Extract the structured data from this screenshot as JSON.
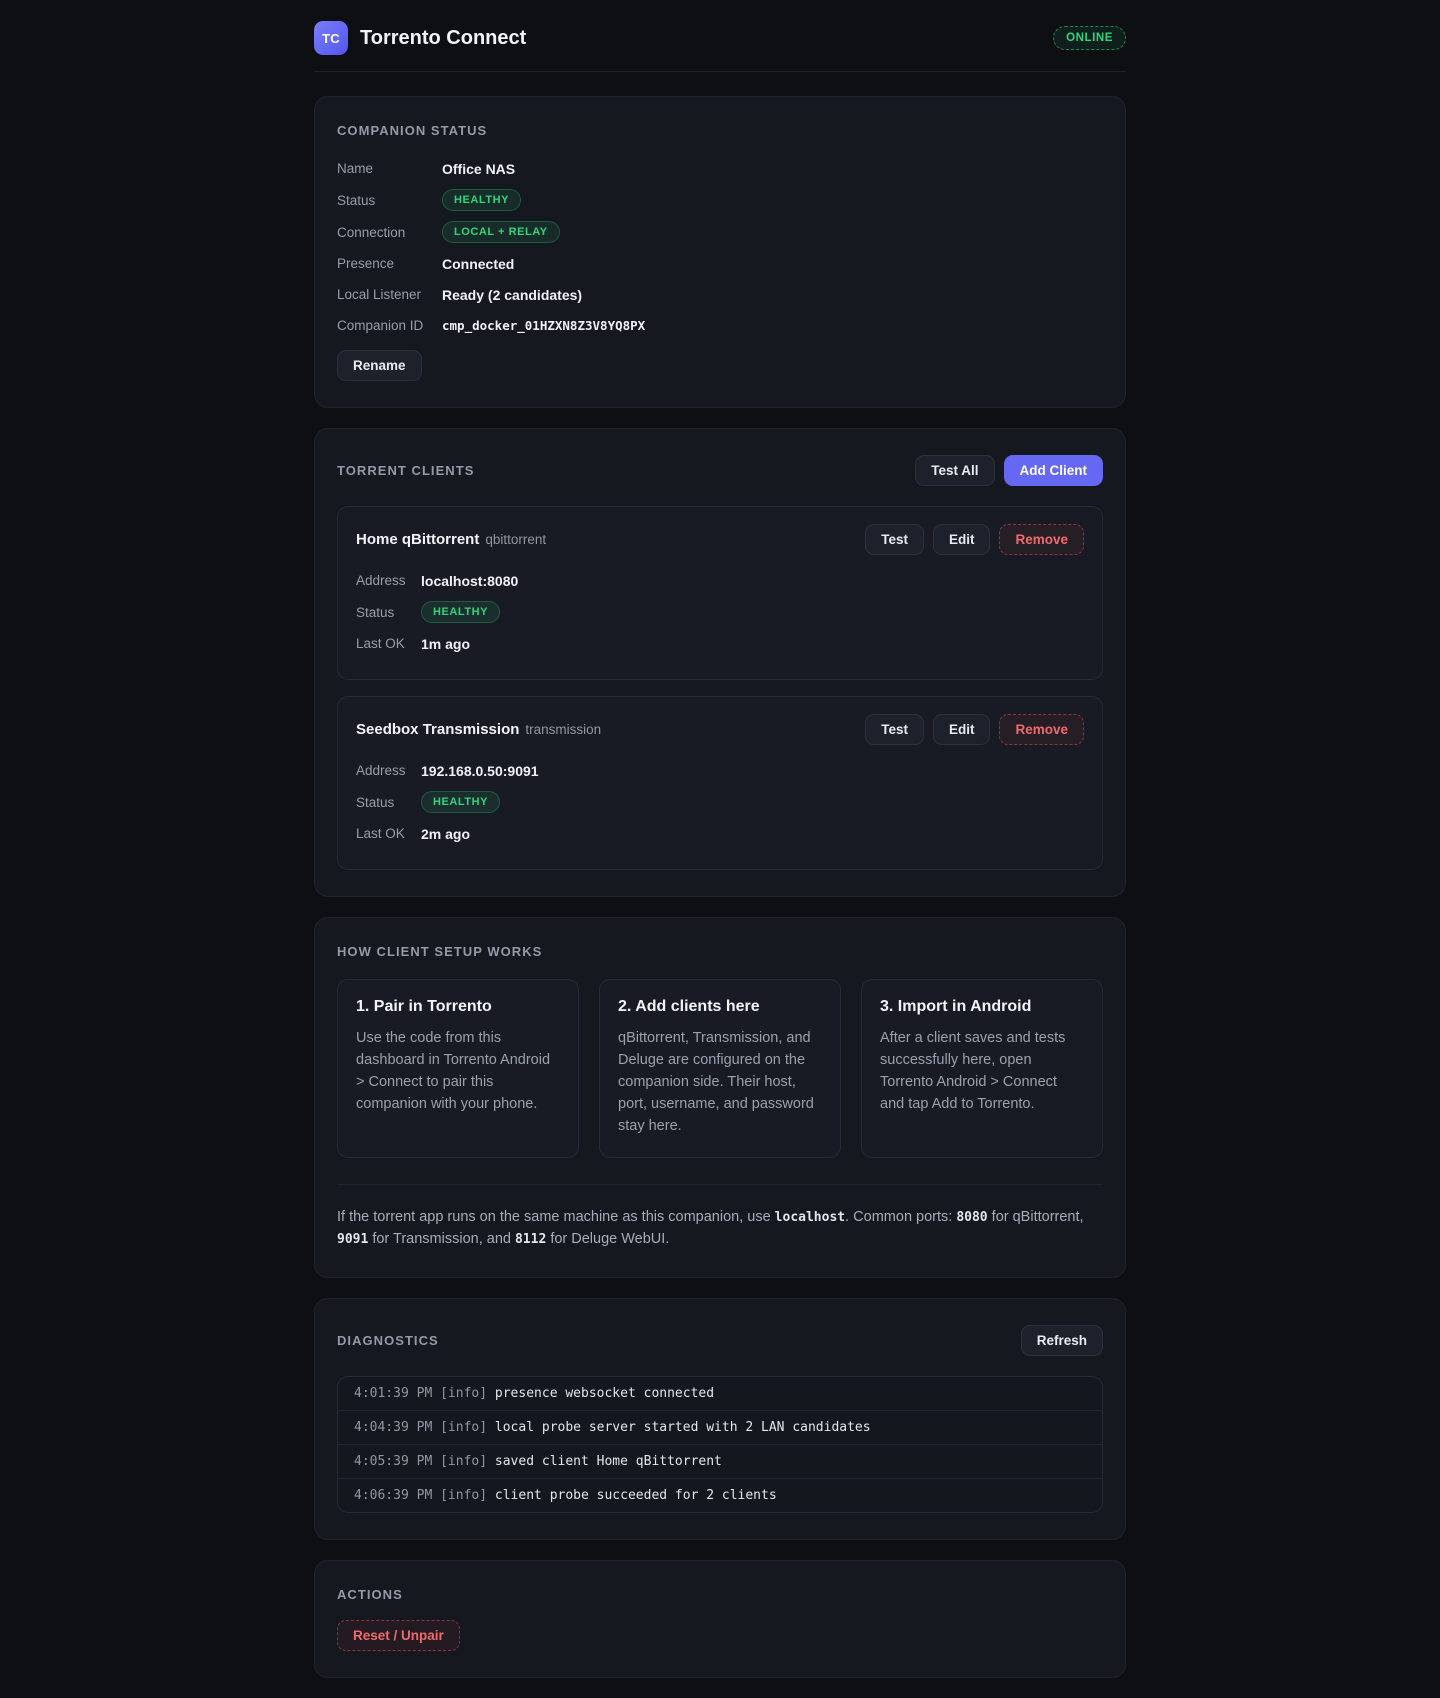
{
  "header": {
    "logo": "TC",
    "title": "Torrento Connect",
    "status_badge": "ONLINE"
  },
  "companion_status": {
    "section_title": "Companion Status",
    "fields": [
      {
        "label": "Name",
        "value": "Office NAS",
        "type": "text"
      },
      {
        "label": "Status",
        "value": "HEALTHY",
        "type": "badge"
      },
      {
        "label": "Connection",
        "value": "LOCAL + RELAY",
        "type": "badge"
      },
      {
        "label": "Presence",
        "value": "Connected",
        "type": "text"
      },
      {
        "label": "Local Listener",
        "value": "Ready (2 candidates)",
        "type": "text"
      },
      {
        "label": "Companion ID",
        "value": "cmp_docker_01HZXN8Z3V8YQ8PX",
        "type": "mono"
      }
    ],
    "rename_button": "Rename"
  },
  "torrent_clients": {
    "section_title": "Torrent Clients",
    "test_all_button": "Test All",
    "add_client_button": "Add Client",
    "field_labels": {
      "address": "Address",
      "status": "Status",
      "last_ok": "Last OK"
    },
    "client_buttons": {
      "test": "Test",
      "edit": "Edit",
      "remove": "Remove"
    },
    "clients": [
      {
        "name": "Home qBittorrent",
        "kind": "qbittorrent",
        "address": "localhost:8080",
        "status": "HEALTHY",
        "last_ok": "1m ago"
      },
      {
        "name": "Seedbox Transmission",
        "kind": "transmission",
        "address": "192.168.0.50:9091",
        "status": "HEALTHY",
        "last_ok": "2m ago"
      }
    ]
  },
  "how_it_works": {
    "section_title": "How Client Setup Works",
    "steps": [
      {
        "title": "1. Pair in Torrento",
        "body": "Use the code from this dashboard in Torrento Android > Connect to pair this companion with your phone."
      },
      {
        "title": "2. Add clients here",
        "body": "qBittorrent, Transmission, and Deluge are configured on the companion side. Their host, port, username, and password stay here."
      },
      {
        "title": "3. Import in Android",
        "body": "After a client saves and tests successfully here, open Torrento Android > Connect and tap Add to Torrento."
      }
    ],
    "note_segments": [
      {
        "text": "If the torrent app runs on the same machine as this companion, use ",
        "style": "plain"
      },
      {
        "text": "localhost",
        "style": "code"
      },
      {
        "text": ". Common ports: ",
        "style": "plain"
      },
      {
        "text": "8080",
        "style": "code"
      },
      {
        "text": " for qBittorrent, ",
        "style": "plain"
      },
      {
        "text": "9091",
        "style": "code"
      },
      {
        "text": " for Transmission, and ",
        "style": "plain"
      },
      {
        "text": "8112",
        "style": "code"
      },
      {
        "text": " for Deluge WebUI.",
        "style": "plain"
      }
    ]
  },
  "diagnostics": {
    "section_title": "Diagnostics",
    "refresh_button": "Refresh",
    "log_lines": [
      {
        "time": "4:01:39 PM",
        "level": "[info]",
        "message": "presence websocket connected"
      },
      {
        "time": "4:04:39 PM",
        "level": "[info]",
        "message": "local probe server started with 2 LAN candidates"
      },
      {
        "time": "4:05:39 PM",
        "level": "[info]",
        "message": "saved client Home qBittorrent"
      },
      {
        "time": "4:06:39 PM",
        "level": "[info]",
        "message": "client probe succeeded for 2 clients"
      }
    ]
  },
  "actions": {
    "section_title": "Actions",
    "reset_button": "Reset / Unpair"
  },
  "colors": {
    "accent": "#6568f2",
    "success": "#2fd57c",
    "danger": "#e5484d",
    "background": "#0d0f13",
    "card": "#15181f"
  }
}
